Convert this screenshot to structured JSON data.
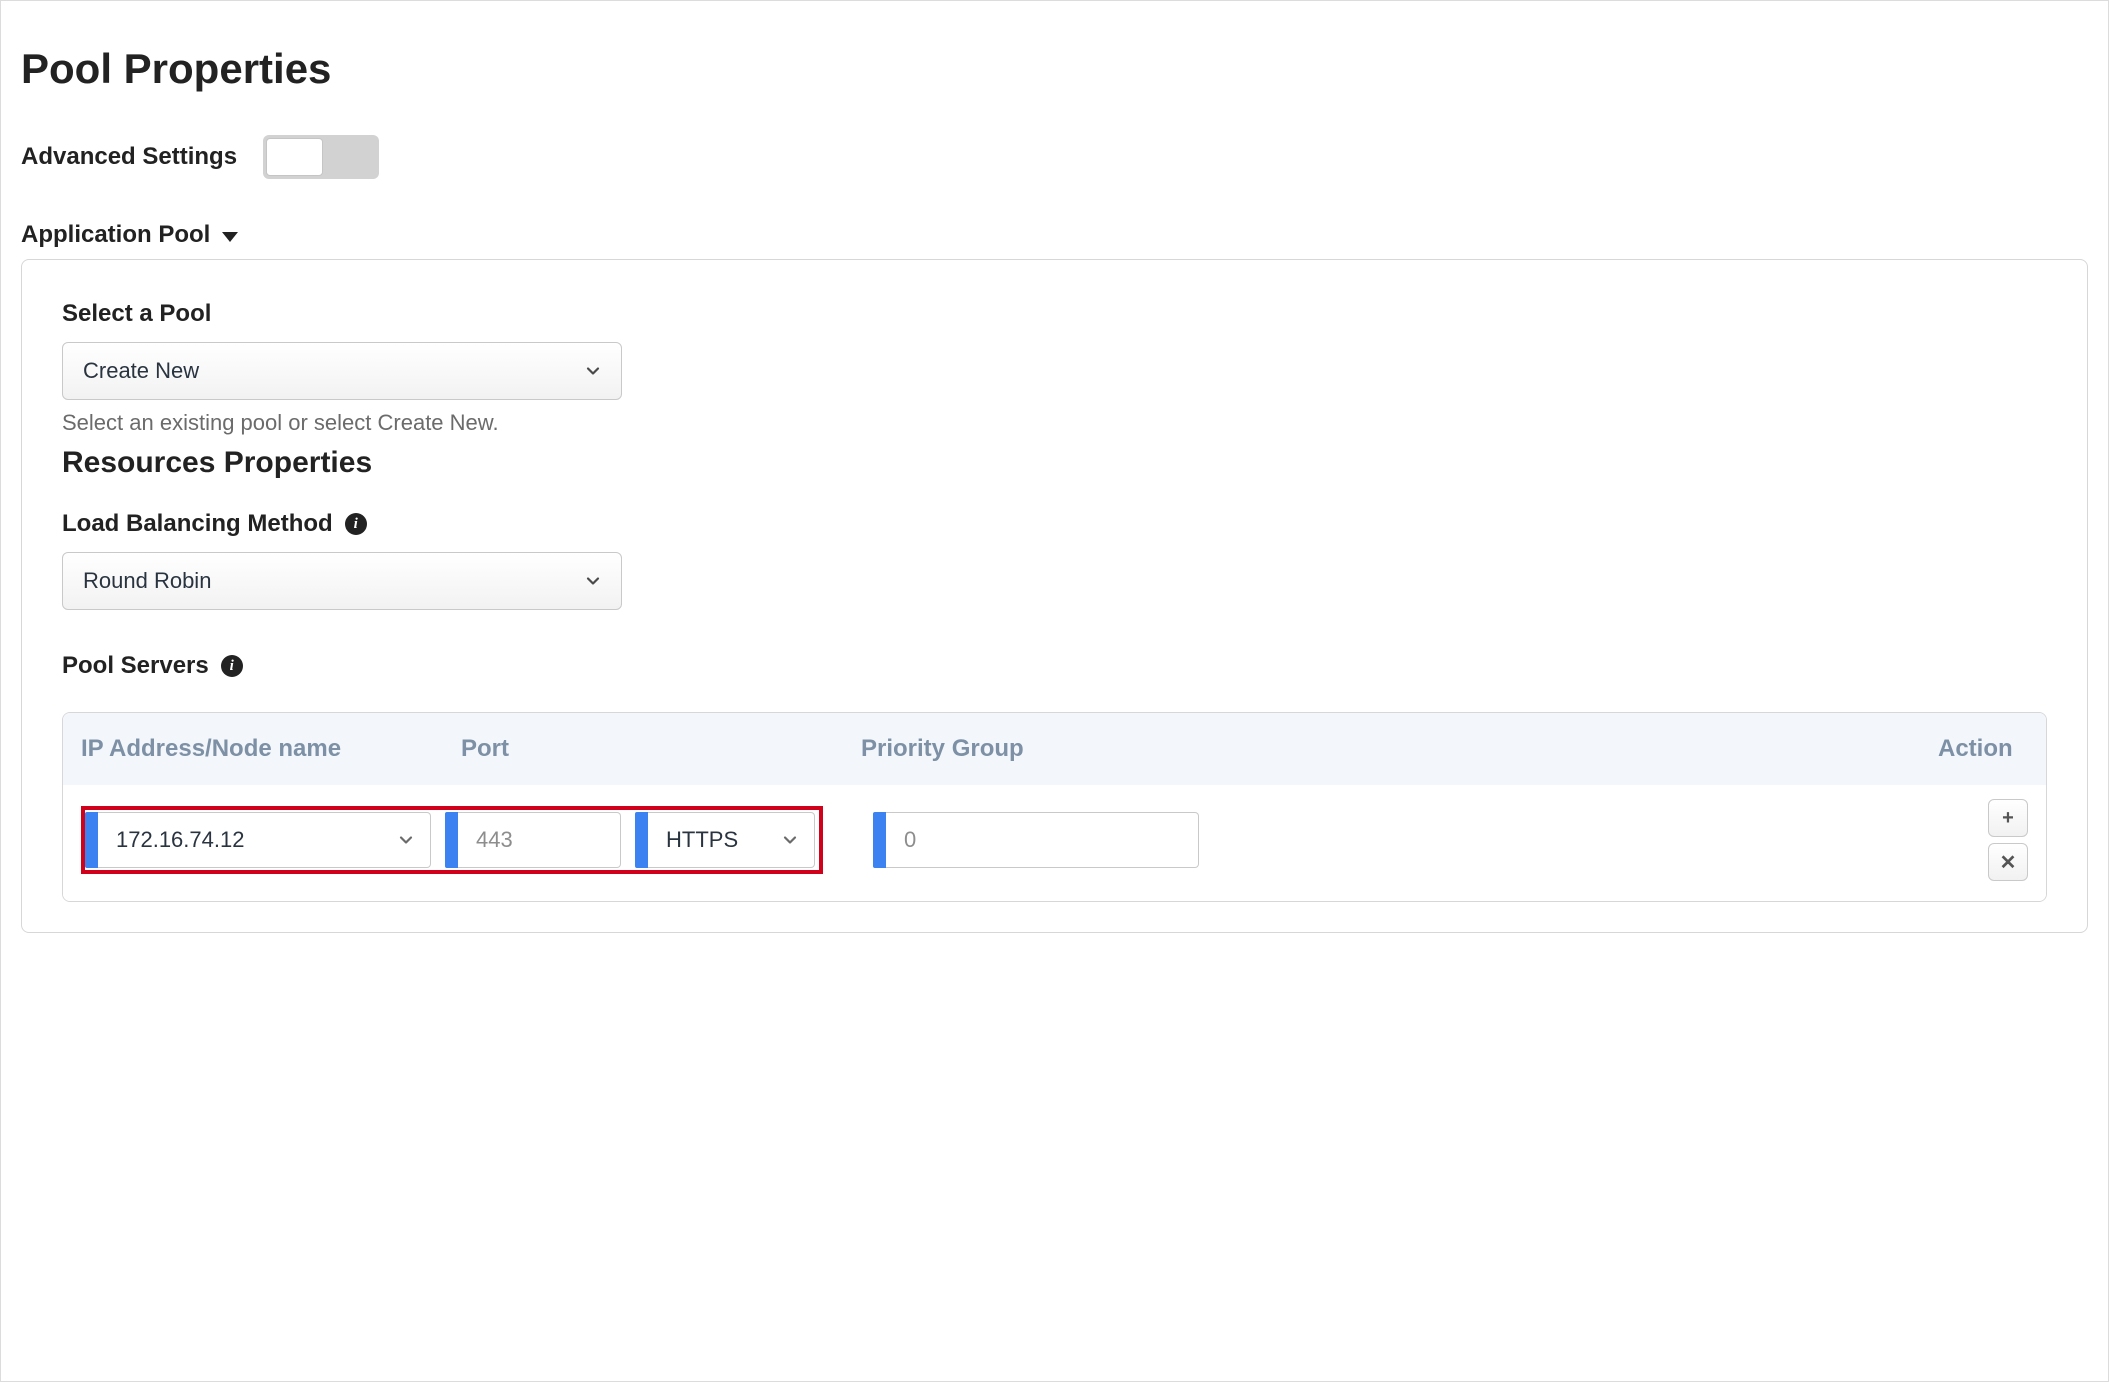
{
  "page": {
    "title": "Pool Properties"
  },
  "advanced": {
    "label": "Advanced Settings",
    "enabled": false
  },
  "section": {
    "title": "Application Pool"
  },
  "selectPool": {
    "label": "Select a Pool",
    "value": "Create New",
    "help": "Select an existing pool or select Create New."
  },
  "resources": {
    "heading": "Resources Properties"
  },
  "lbMethod": {
    "label": "Load Balancing Method",
    "value": "Round Robin"
  },
  "poolServers": {
    "label": "Pool Servers",
    "columns": {
      "ip": "IP Address/Node name",
      "port": "Port",
      "priority": "Priority Group",
      "action": "Action"
    },
    "rows": [
      {
        "ip": "172.16.74.12",
        "port": "443",
        "protocol": "HTTPS",
        "priority": "0"
      }
    ]
  },
  "icons": {
    "plus": "+",
    "close": "✕"
  }
}
